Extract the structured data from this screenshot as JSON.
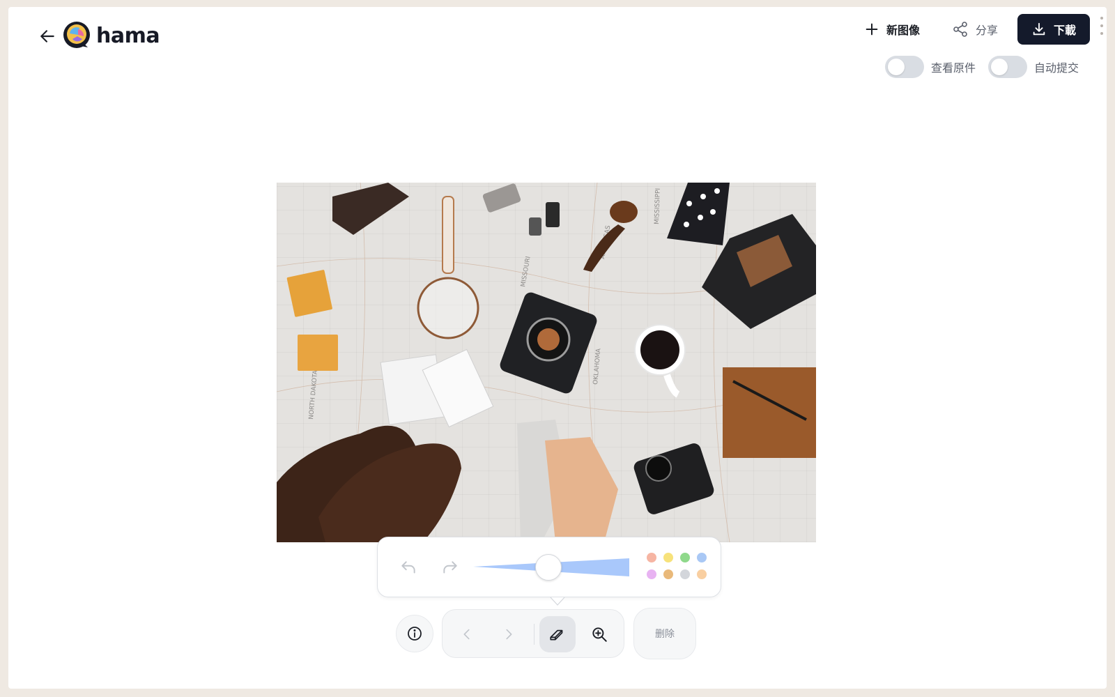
{
  "header": {
    "brand": "hama",
    "new_image_label": "新图像",
    "share_label": "分享",
    "download_label": "下載"
  },
  "toggles": [
    {
      "label": "查看原件",
      "on": false
    },
    {
      "label": "自动提交",
      "on": false
    }
  ],
  "brush_panel": {
    "brush_size_fraction": 0.48,
    "swatches": [
      "#f6b5a3",
      "#f7e27b",
      "#8fd98b",
      "#a9c8f5",
      "#e8b3f2",
      "#e9b97a",
      "#d3d6db",
      "#f9cfa1"
    ]
  },
  "toolbar": {
    "delete_label": "删除"
  },
  "photo": {
    "map_labels": [
      "MISSOURI",
      "MISSISSIPPI",
      "ARKANSAS",
      "NORTH DAKOTA",
      "OKLAHOMA"
    ]
  },
  "colors": {
    "primary_dark": "#141a2b",
    "slider_fill": "#a9c8fb"
  }
}
